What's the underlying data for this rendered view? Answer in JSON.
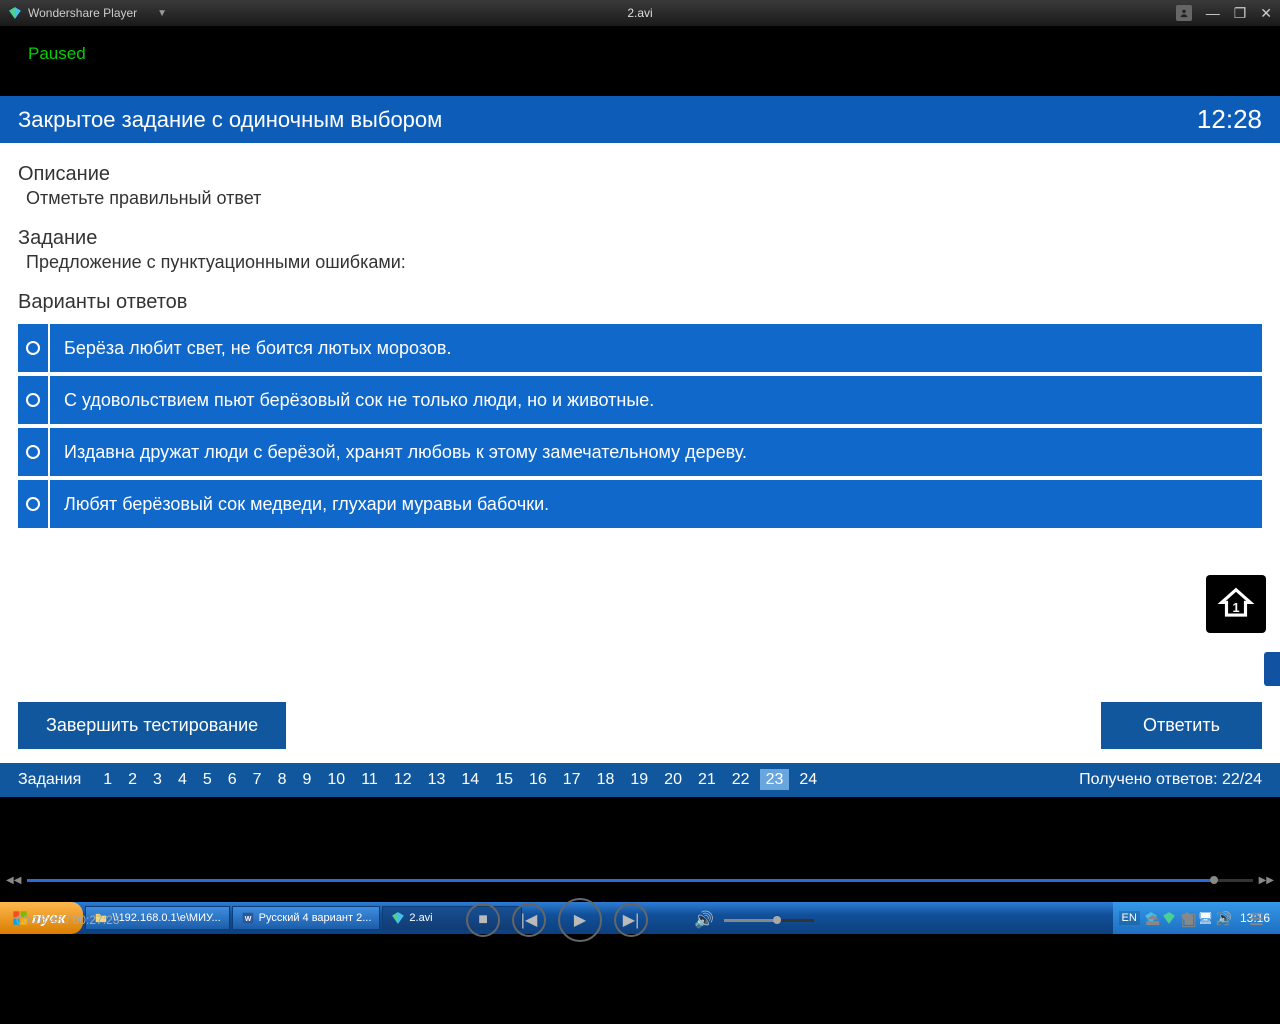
{
  "titlebar": {
    "app_name": "Wondershare Player",
    "file_title": "2.avi"
  },
  "player": {
    "paused_label": "Paused",
    "timecode": "00:26:48 / 00:27:23"
  },
  "test": {
    "title": "Закрытое задание с одиночным выбором",
    "timer": "12:28",
    "description_label": "Описание",
    "description_text": "Отметьте правильный ответ",
    "task_label": "Задание",
    "task_text": "Предложение с пунктуационными ошибками:",
    "options_label": "Варианты ответов",
    "options": [
      "Берёза любит свет, не боится лютых морозов.",
      "С удовольствием пьют берёзовый сок не только люди, но и животные.",
      "Издавна дружат люди с берёзой, хранят любовь к этому замечательному дереву.",
      "Любят берёзовый сок медведи, глухари муравьи бабочки."
    ],
    "finish_label": "Завершить тестирование",
    "answer_label": "Ответить",
    "nav_label": "Задания",
    "nav_numbers": [
      "1",
      "2",
      "3",
      "4",
      "5",
      "6",
      "7",
      "8",
      "9",
      "10",
      "11",
      "12",
      "13",
      "14",
      "15",
      "16",
      "17",
      "18",
      "19",
      "20",
      "21",
      "22",
      "23",
      "24"
    ],
    "nav_active": "23",
    "score_label": "Получено ответов: 22/24"
  },
  "taskbar": {
    "start": "пуск",
    "items": [
      {
        "icon": "folder",
        "label": "\\\\192.168.0.1\\e\\МИУ..."
      },
      {
        "icon": "word",
        "label": "Русский 4 вариант 2..."
      },
      {
        "icon": "wondershare",
        "label": "2.avi",
        "active": true
      }
    ],
    "lang": "EN",
    "clock": "13:16"
  }
}
